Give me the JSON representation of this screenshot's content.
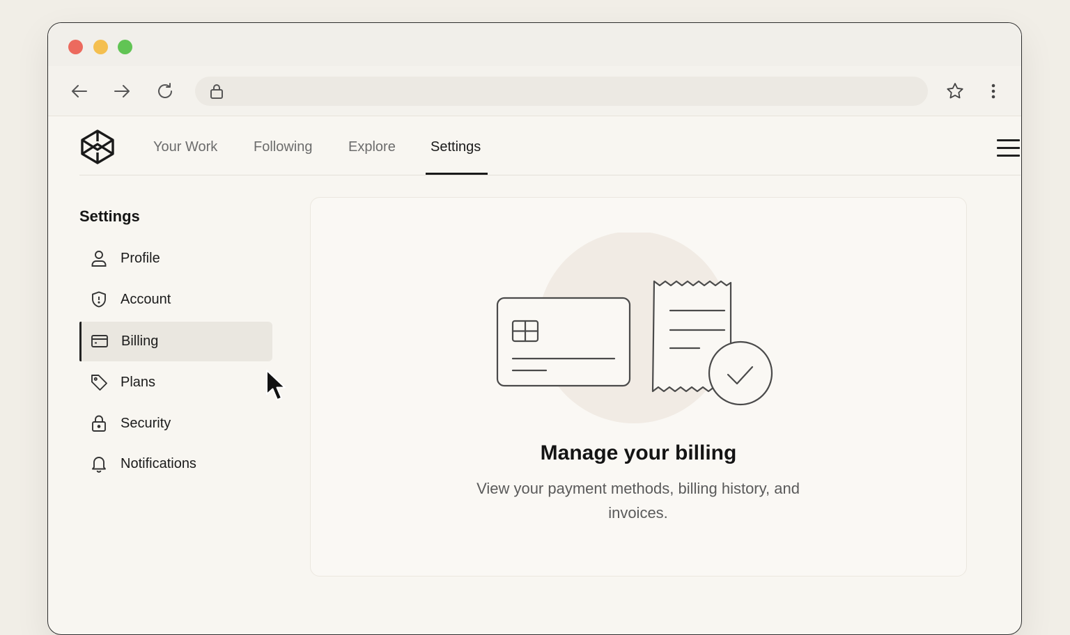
{
  "browser": {
    "window_controls": [
      "close",
      "minimize",
      "maximize"
    ],
    "address_url": "",
    "icons": [
      "back-arrow-icon",
      "forward-arrow-icon",
      "reload-icon",
      "lock-icon",
      "star-icon",
      "more-vertical-icon"
    ]
  },
  "nav": {
    "logo_icon": "codepen-cube-logo",
    "tabs": [
      {
        "label": "Your Work",
        "active": false
      },
      {
        "label": "Following",
        "active": false
      },
      {
        "label": "Explore",
        "active": false
      },
      {
        "label": "Settings",
        "active": true
      }
    ],
    "menu_icon": "hamburger-icon"
  },
  "sidebar": {
    "title": "Settings",
    "items": [
      {
        "label": "Profile",
        "icon": "user-icon",
        "active": false
      },
      {
        "label": "Account",
        "icon": "shield-icon",
        "active": false
      },
      {
        "label": "Billing",
        "icon": "credit-card-icon",
        "active": true
      },
      {
        "label": "Plans",
        "icon": "tag-icon",
        "active": false
      },
      {
        "label": "Security",
        "icon": "lock-icon",
        "active": false
      },
      {
        "label": "Notifications",
        "icon": "bell-icon",
        "active": false
      }
    ]
  },
  "main": {
    "illustration": "credit-card-and-receipt-with-check",
    "title": "Manage your billing",
    "description": "View your payment methods, billing history, and invoices."
  },
  "colors": {
    "background": "#f1eee7",
    "window": "#f8f6f1",
    "accent": "#1a1a1a",
    "traffic_red": "#ec6a5e",
    "traffic_yellow": "#f4bf4f",
    "traffic_green": "#61c454"
  }
}
